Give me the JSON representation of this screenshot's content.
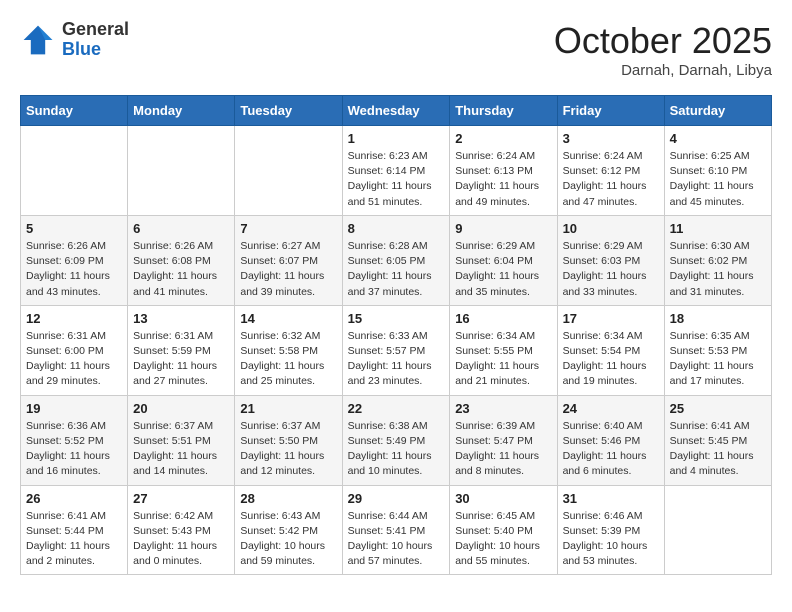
{
  "header": {
    "logo_general": "General",
    "logo_blue": "Blue",
    "month": "October 2025",
    "location": "Darnah, Darnah, Libya"
  },
  "weekdays": [
    "Sunday",
    "Monday",
    "Tuesday",
    "Wednesday",
    "Thursday",
    "Friday",
    "Saturday"
  ],
  "weeks": [
    [
      {
        "day": "",
        "sunrise": "",
        "sunset": "",
        "daylight": ""
      },
      {
        "day": "",
        "sunrise": "",
        "sunset": "",
        "daylight": ""
      },
      {
        "day": "",
        "sunrise": "",
        "sunset": "",
        "daylight": ""
      },
      {
        "day": "1",
        "sunrise": "Sunrise: 6:23 AM",
        "sunset": "Sunset: 6:14 PM",
        "daylight": "Daylight: 11 hours and 51 minutes."
      },
      {
        "day": "2",
        "sunrise": "Sunrise: 6:24 AM",
        "sunset": "Sunset: 6:13 PM",
        "daylight": "Daylight: 11 hours and 49 minutes."
      },
      {
        "day": "3",
        "sunrise": "Sunrise: 6:24 AM",
        "sunset": "Sunset: 6:12 PM",
        "daylight": "Daylight: 11 hours and 47 minutes."
      },
      {
        "day": "4",
        "sunrise": "Sunrise: 6:25 AM",
        "sunset": "Sunset: 6:10 PM",
        "daylight": "Daylight: 11 hours and 45 minutes."
      }
    ],
    [
      {
        "day": "5",
        "sunrise": "Sunrise: 6:26 AM",
        "sunset": "Sunset: 6:09 PM",
        "daylight": "Daylight: 11 hours and 43 minutes."
      },
      {
        "day": "6",
        "sunrise": "Sunrise: 6:26 AM",
        "sunset": "Sunset: 6:08 PM",
        "daylight": "Daylight: 11 hours and 41 minutes."
      },
      {
        "day": "7",
        "sunrise": "Sunrise: 6:27 AM",
        "sunset": "Sunset: 6:07 PM",
        "daylight": "Daylight: 11 hours and 39 minutes."
      },
      {
        "day": "8",
        "sunrise": "Sunrise: 6:28 AM",
        "sunset": "Sunset: 6:05 PM",
        "daylight": "Daylight: 11 hours and 37 minutes."
      },
      {
        "day": "9",
        "sunrise": "Sunrise: 6:29 AM",
        "sunset": "Sunset: 6:04 PM",
        "daylight": "Daylight: 11 hours and 35 minutes."
      },
      {
        "day": "10",
        "sunrise": "Sunrise: 6:29 AM",
        "sunset": "Sunset: 6:03 PM",
        "daylight": "Daylight: 11 hours and 33 minutes."
      },
      {
        "day": "11",
        "sunrise": "Sunrise: 6:30 AM",
        "sunset": "Sunset: 6:02 PM",
        "daylight": "Daylight: 11 hours and 31 minutes."
      }
    ],
    [
      {
        "day": "12",
        "sunrise": "Sunrise: 6:31 AM",
        "sunset": "Sunset: 6:00 PM",
        "daylight": "Daylight: 11 hours and 29 minutes."
      },
      {
        "day": "13",
        "sunrise": "Sunrise: 6:31 AM",
        "sunset": "Sunset: 5:59 PM",
        "daylight": "Daylight: 11 hours and 27 minutes."
      },
      {
        "day": "14",
        "sunrise": "Sunrise: 6:32 AM",
        "sunset": "Sunset: 5:58 PM",
        "daylight": "Daylight: 11 hours and 25 minutes."
      },
      {
        "day": "15",
        "sunrise": "Sunrise: 6:33 AM",
        "sunset": "Sunset: 5:57 PM",
        "daylight": "Daylight: 11 hours and 23 minutes."
      },
      {
        "day": "16",
        "sunrise": "Sunrise: 6:34 AM",
        "sunset": "Sunset: 5:55 PM",
        "daylight": "Daylight: 11 hours and 21 minutes."
      },
      {
        "day": "17",
        "sunrise": "Sunrise: 6:34 AM",
        "sunset": "Sunset: 5:54 PM",
        "daylight": "Daylight: 11 hours and 19 minutes."
      },
      {
        "day": "18",
        "sunrise": "Sunrise: 6:35 AM",
        "sunset": "Sunset: 5:53 PM",
        "daylight": "Daylight: 11 hours and 17 minutes."
      }
    ],
    [
      {
        "day": "19",
        "sunrise": "Sunrise: 6:36 AM",
        "sunset": "Sunset: 5:52 PM",
        "daylight": "Daylight: 11 hours and 16 minutes."
      },
      {
        "day": "20",
        "sunrise": "Sunrise: 6:37 AM",
        "sunset": "Sunset: 5:51 PM",
        "daylight": "Daylight: 11 hours and 14 minutes."
      },
      {
        "day": "21",
        "sunrise": "Sunrise: 6:37 AM",
        "sunset": "Sunset: 5:50 PM",
        "daylight": "Daylight: 11 hours and 12 minutes."
      },
      {
        "day": "22",
        "sunrise": "Sunrise: 6:38 AM",
        "sunset": "Sunset: 5:49 PM",
        "daylight": "Daylight: 11 hours and 10 minutes."
      },
      {
        "day": "23",
        "sunrise": "Sunrise: 6:39 AM",
        "sunset": "Sunset: 5:47 PM",
        "daylight": "Daylight: 11 hours and 8 minutes."
      },
      {
        "day": "24",
        "sunrise": "Sunrise: 6:40 AM",
        "sunset": "Sunset: 5:46 PM",
        "daylight": "Daylight: 11 hours and 6 minutes."
      },
      {
        "day": "25",
        "sunrise": "Sunrise: 6:41 AM",
        "sunset": "Sunset: 5:45 PM",
        "daylight": "Daylight: 11 hours and 4 minutes."
      }
    ],
    [
      {
        "day": "26",
        "sunrise": "Sunrise: 6:41 AM",
        "sunset": "Sunset: 5:44 PM",
        "daylight": "Daylight: 11 hours and 2 minutes."
      },
      {
        "day": "27",
        "sunrise": "Sunrise: 6:42 AM",
        "sunset": "Sunset: 5:43 PM",
        "daylight": "Daylight: 11 hours and 0 minutes."
      },
      {
        "day": "28",
        "sunrise": "Sunrise: 6:43 AM",
        "sunset": "Sunset: 5:42 PM",
        "daylight": "Daylight: 10 hours and 59 minutes."
      },
      {
        "day": "29",
        "sunrise": "Sunrise: 6:44 AM",
        "sunset": "Sunset: 5:41 PM",
        "daylight": "Daylight: 10 hours and 57 minutes."
      },
      {
        "day": "30",
        "sunrise": "Sunrise: 6:45 AM",
        "sunset": "Sunset: 5:40 PM",
        "daylight": "Daylight: 10 hours and 55 minutes."
      },
      {
        "day": "31",
        "sunrise": "Sunrise: 6:46 AM",
        "sunset": "Sunset: 5:39 PM",
        "daylight": "Daylight: 10 hours and 53 minutes."
      },
      {
        "day": "",
        "sunrise": "",
        "sunset": "",
        "daylight": ""
      }
    ]
  ]
}
